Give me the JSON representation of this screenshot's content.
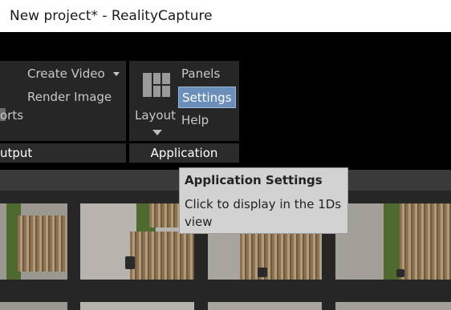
{
  "window": {
    "title": "New project* - RealityCapture"
  },
  "ribbon": {
    "output_group": {
      "label": "utput",
      "partial_label": "orts",
      "create_video_label": "Create Video",
      "render_image_label": "Render Image"
    },
    "application_group": {
      "label": "Application",
      "layout_label": "Layout",
      "panels_label": "Panels",
      "settings_label": "Settings",
      "help_label": "Help"
    }
  },
  "tooltip": {
    "title": "Application Settings",
    "text": "Click to display in the 1Ds view"
  },
  "colors": {
    "selected_button": "#6b8fba",
    "ribbon_background": "#262626",
    "group_label_background": "#2b2b2b",
    "tooltip_background": "#d2d2d2"
  },
  "icons": [
    "layout-grid-icon",
    "dropdown-arrow-icon"
  ]
}
